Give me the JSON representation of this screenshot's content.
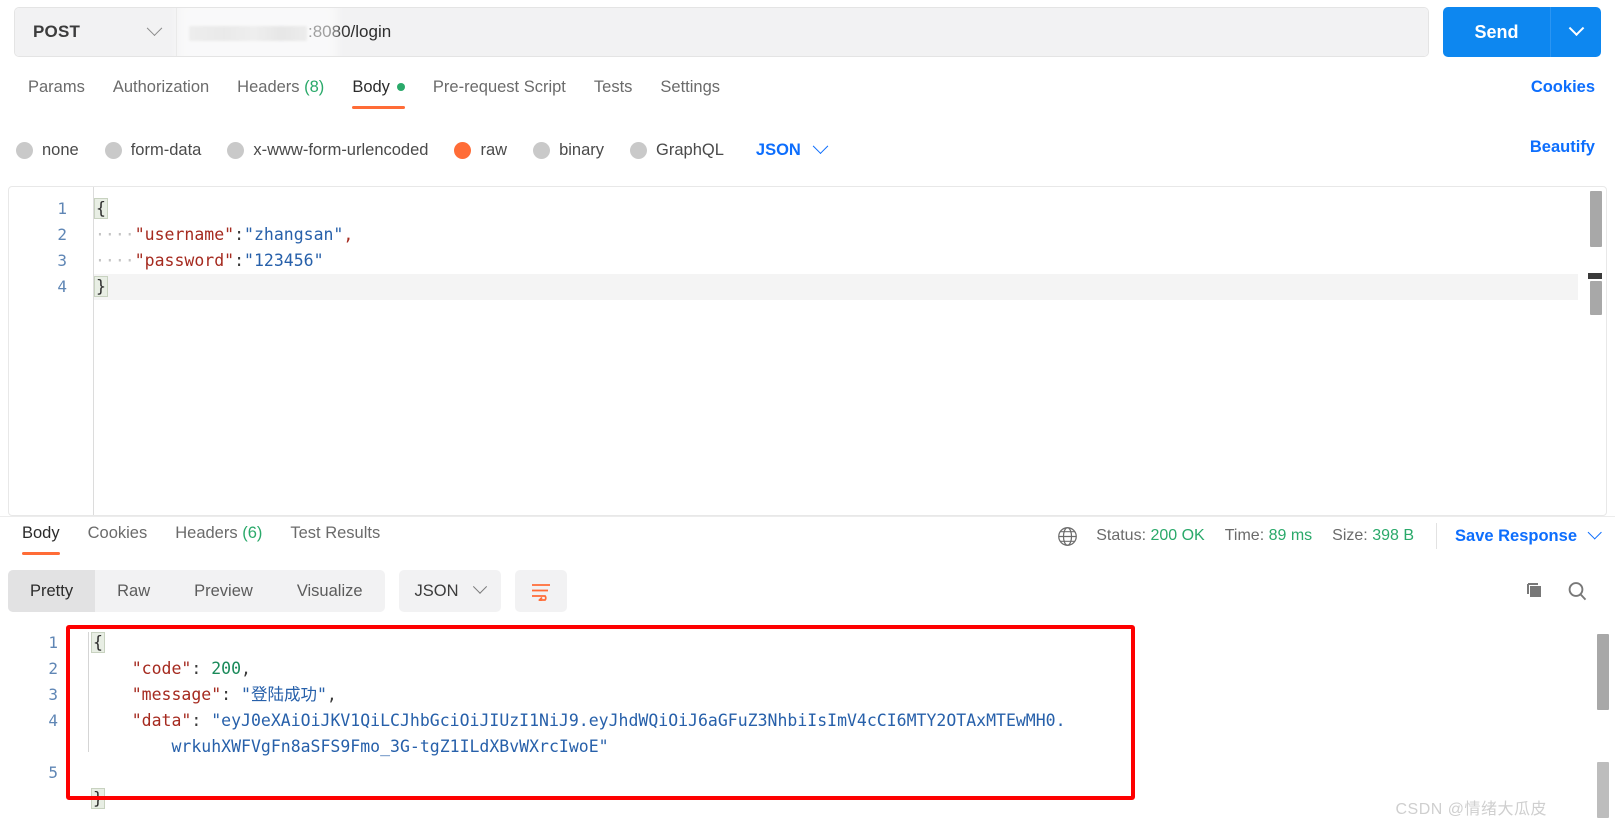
{
  "request": {
    "method": "POST",
    "url_redacted": true,
    "url_text": ":8080/login",
    "send_label": "Send",
    "tabs": [
      {
        "label": "Params",
        "active": false
      },
      {
        "label": "Authorization",
        "active": false
      },
      {
        "label": "Headers",
        "count": "(8)",
        "active": false
      },
      {
        "label": "Body",
        "active": true,
        "dot": true
      },
      {
        "label": "Pre-request Script",
        "active": false
      },
      {
        "label": "Tests",
        "active": false
      },
      {
        "label": "Settings",
        "active": false
      }
    ],
    "cookies_link": "Cookies",
    "beautify_link": "Beautify",
    "body_types": [
      {
        "label": "none",
        "selected": false
      },
      {
        "label": "form-data",
        "selected": false
      },
      {
        "label": "x-www-form-urlencoded",
        "selected": false
      },
      {
        "label": "raw",
        "selected": true
      },
      {
        "label": "binary",
        "selected": false
      },
      {
        "label": "GraphQL",
        "selected": false
      }
    ],
    "format": "JSON",
    "editor": {
      "line_numbers": [
        "1",
        "2",
        "3",
        "4"
      ],
      "lines": [
        {
          "open_brace": "{"
        },
        {
          "indent": "····",
          "key": "\"username\"",
          "colon": ":",
          "value": "\"zhangsan\"",
          "tail": ","
        },
        {
          "indent": "····",
          "key": "\"password\"",
          "colon": ":",
          "value": "\"123456\"",
          "tail": ""
        },
        {
          "close_brace": "}"
        }
      ]
    }
  },
  "response": {
    "tabs": [
      {
        "label": "Body",
        "active": true
      },
      {
        "label": "Cookies",
        "active": false
      },
      {
        "label": "Headers",
        "count": "(6)",
        "active": false
      },
      {
        "label": "Test Results",
        "active": false
      }
    ],
    "status_label": "Status:",
    "status_value": "200 OK",
    "time_label": "Time:",
    "time_value": "89 ms",
    "size_label": "Size:",
    "size_value": "398 B",
    "save_response": "Save Response",
    "view_modes": [
      {
        "label": "Pretty",
        "active": true
      },
      {
        "label": "Raw",
        "active": false
      },
      {
        "label": "Preview",
        "active": false
      },
      {
        "label": "Visualize",
        "active": false
      }
    ],
    "format": "JSON",
    "line_numbers": [
      "1",
      "2",
      "3",
      "4",
      "5"
    ],
    "body_lines": [
      {
        "text": "{",
        "type": "brace-open"
      },
      {
        "indent": "    ",
        "key": "\"code\"",
        "colon": ": ",
        "value": "200",
        "vtype": "number",
        "tail": ","
      },
      {
        "indent": "    ",
        "key": "\"message\"",
        "colon": ": ",
        "value": "\"登陆成功\"",
        "vtype": "string",
        "tail": ","
      },
      {
        "indent": "    ",
        "key": "\"data\"",
        "colon": ": ",
        "value": "\"eyJ0eXAiOiJKV1QiLCJhbGciOiJIUzI1NiJ9.eyJhdWQiOiJ6aGFuZ3NhbiIsImV4cCI6MTY2OTAxMTEwMH0.",
        "vtype": "string",
        "tail": ""
      },
      {
        "indent": "        ",
        "value": "wrkuhXWFVgFn8aSFS9Fmo_3G-tgZ1ILdXBvWXrcIwoE\"",
        "vtype": "string",
        "tail": "",
        "continuation": true
      },
      {
        "text": "}",
        "type": "brace-close"
      }
    ],
    "highlight_box_color": "#fe0000"
  },
  "icons": {
    "globe": "globe-icon",
    "copy": "copy-icon",
    "search": "search-icon",
    "wrap": "wrap-lines-icon"
  },
  "watermark": "CSDN @情绪大瓜皮",
  "colors": {
    "accent_orange": "#ff6c37",
    "link_blue": "#0d6efd",
    "send_blue": "#0d87f0",
    "success_green": "#2aa96a",
    "highlight_red": "#fe0000"
  }
}
